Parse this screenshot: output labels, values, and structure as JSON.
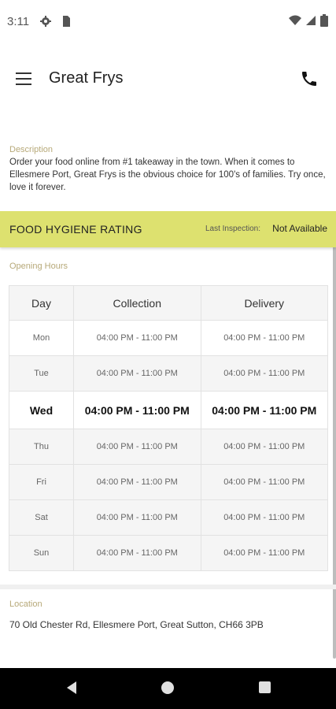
{
  "status_bar": {
    "time": "3:11"
  },
  "app_bar": {
    "title": "Great Frys"
  },
  "description": {
    "label": "Description",
    "text": "Order your food online from #1 takeaway in the town. When it comes to Ellesmere Port, Great Frys is the obvious choice for 100's of families. Try once, love it forever."
  },
  "hygiene": {
    "title": "FOOD HYGIENE RATING",
    "last_inspection_label": "Last Inspection:",
    "value": "Not Available"
  },
  "opening_hours": {
    "label": "Opening Hours",
    "headers": [
      "Day",
      "Collection",
      "Delivery"
    ],
    "rows": [
      {
        "day": "Mon",
        "collection": "04:00 PM - 11:00 PM",
        "delivery": "04:00 PM - 11:00 PM"
      },
      {
        "day": "Tue",
        "collection": "04:00 PM - 11:00 PM",
        "delivery": "04:00 PM - 11:00 PM"
      },
      {
        "day": "Wed",
        "collection": "04:00 PM - 11:00 PM",
        "delivery": "04:00 PM - 11:00 PM"
      },
      {
        "day": "Thu",
        "collection": "04:00 PM - 11:00 PM",
        "delivery": "04:00 PM - 11:00 PM"
      },
      {
        "day": "Fri",
        "collection": "04:00 PM - 11:00 PM",
        "delivery": "04:00 PM - 11:00 PM"
      },
      {
        "day": "Sat",
        "collection": "04:00 PM - 11:00 PM",
        "delivery": "04:00 PM - 11:00 PM"
      },
      {
        "day": "Sun",
        "collection": "04:00 PM - 11:00 PM",
        "delivery": "04:00 PM - 11:00 PM"
      }
    ]
  },
  "location": {
    "label": "Location",
    "address": "70 Old Chester Rd, Ellesmere Port, Great Sutton, CH66 3PB"
  },
  "colors": {
    "hygiene_bar": "#dde16f",
    "label_accent": "#b7a979"
  }
}
